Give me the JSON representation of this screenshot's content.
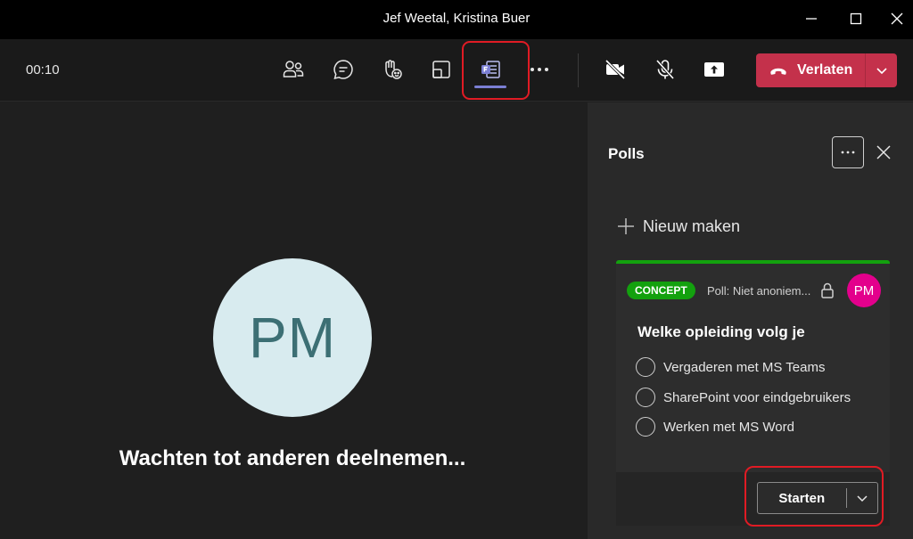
{
  "window": {
    "title": "Jef Weetal, Kristina Buer"
  },
  "toolbar": {
    "timer": "00:10",
    "leave_label": "Verlaten",
    "colors": {
      "leave": "#c4314b",
      "highlight": "#e01b24",
      "apps_accent": "#7b7fd4"
    }
  },
  "stage": {
    "avatar_initials": "PM",
    "waiting_text": "Wachten tot anderen deelnemen..."
  },
  "panel": {
    "title": "Polls",
    "new_label": "Nieuw maken",
    "card": {
      "badge": "CONCEPT",
      "meta": "Poll: Niet anoniem...",
      "avatar_initials": "PM",
      "question": "Welke opleiding volg je",
      "options": [
        "Vergaderen met MS Teams",
        "SharePoint voor eindgebruikers",
        "Werken met MS Word"
      ],
      "start_label": "Starten",
      "colors": {
        "badge": "#13a10e",
        "avatar": "#e3008c"
      }
    }
  }
}
